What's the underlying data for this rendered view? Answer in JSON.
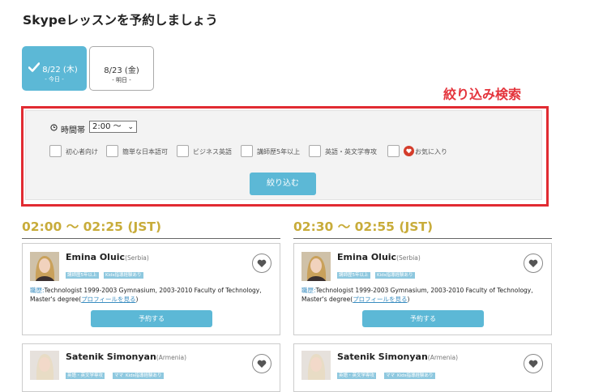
{
  "page": {
    "title": "Skypeレッスンを予約しましょう"
  },
  "date_tabs": [
    {
      "date": "8/22 (木)",
      "sub": "- 今日 -",
      "selected": true
    },
    {
      "date": "8/23 (金)",
      "sub": "- 明日 -",
      "selected": false
    }
  ],
  "search": {
    "heading": "絞り込み検索",
    "time_label": "時間帯",
    "time_value": "2:00 ～",
    "options": [
      "初心者向け",
      "簡単な日本語可",
      "ビジネス英語",
      "講師歴5年以上",
      "英語・英文学専攻",
      "お気に入り"
    ],
    "submit_label": "絞り込む",
    "accent_color": "#e12b32"
  },
  "slots": [
    {
      "time": "02:00 ～ 02:25 (JST)",
      "teachers": [
        {
          "name": "Emina Oluic",
          "country": "(Serbia)",
          "tags": [
            "講師歴5年以上",
            "Kids指導経験あり"
          ],
          "bio_key": "職歴:",
          "bio_text": "Technologist 1999-2003 Gymnasium, 2003-2010 Faculty of Technology, Master's degree(",
          "bio_link": "プロフィールを見る",
          "bio_end": ")",
          "reserve_label": "予約する"
        },
        {
          "name": "Satenik Simonyan",
          "country": "(Armenia)",
          "tags": [
            "英語・英文学専攻",
            "ママ",
            "Kids指導経験あり"
          ]
        }
      ]
    },
    {
      "time": "02:30 ～ 02:55 (JST)",
      "teachers": [
        {
          "name": "Emina Oluic",
          "country": "(Serbia)",
          "tags": [
            "講師歴5年以上",
            "Kids指導経験あり"
          ],
          "bio_key": "職歴:",
          "bio_text": "Technologist 1999-2003 Gymnasium, 2003-2010 Faculty of Technology, Master's degree(",
          "bio_link": "プロフィールを見る",
          "bio_end": ")",
          "reserve_label": "予約する"
        },
        {
          "name": "Satenik Simonyan",
          "country": "(Armenia)",
          "tags": [
            "英語・英文学専攻",
            "ママ",
            "Kids指導経験あり"
          ]
        }
      ]
    }
  ],
  "colors": {
    "primary": "#5cb8d6",
    "time_heading": "#c8ac3a",
    "favorite": "#d43c2a"
  }
}
